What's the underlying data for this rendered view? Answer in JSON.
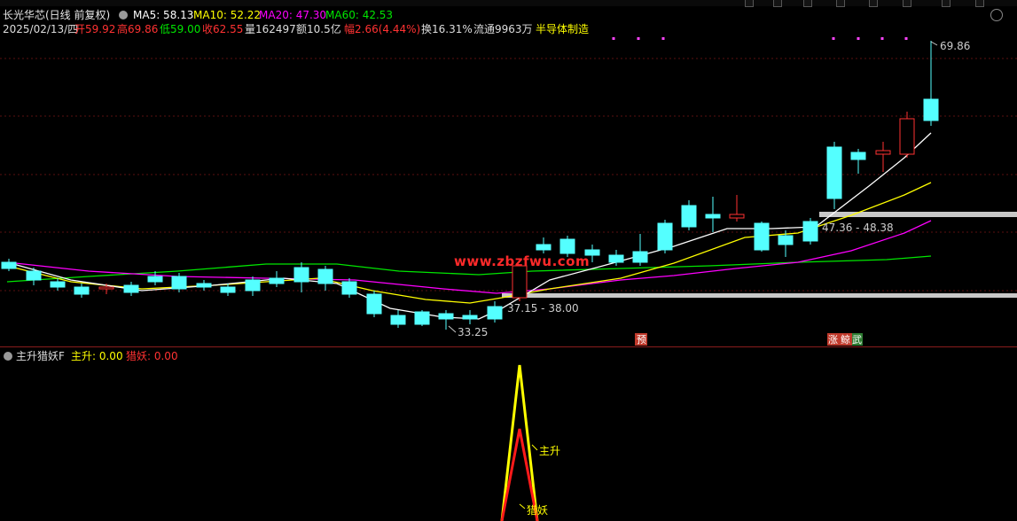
{
  "header": {
    "stock_name": "长光华芯(日线 前复权)",
    "ma5_label": "MA5: 58.13",
    "ma10_label": "MA10: 52.22",
    "ma20_label": "MA20: 47.30",
    "ma60_label": "MA60: 42.53",
    "date": "2025/02/13/四",
    "open": "开59.92",
    "high": "高69.86",
    "low": "低59.00",
    "close": "收62.55",
    "volume": "量162497",
    "amount": "额10.5亿",
    "change": "幅2.66(4.44%)",
    "turnover": "换16.31%",
    "float": "流通9963万",
    "sector": "半导体制造"
  },
  "chart": {
    "annotation_high": "69.86",
    "annotation_low": "33.25",
    "annotation_range1": "37.15 - 38.00",
    "annotation_range2": "47.36 - 48.38",
    "marker_yu": "预",
    "marker_zhang": "涨",
    "marker_jing": "鲸",
    "marker_wu": "武",
    "watermark": "www.zbzfwu.com"
  },
  "indicator": {
    "name": "主升猎妖F",
    "zhusheng_label": "主升: 0.00",
    "lieyao_label": "猎妖: 0.00",
    "zhusheng_arrow": "主升",
    "lieyao_arrow": "猎妖"
  },
  "colors": {
    "up": "#ff3232",
    "down": "#54ffff",
    "ma5": "#ffffff",
    "ma10": "#ffff00",
    "ma20": "#ff00ff",
    "ma60": "#00e600"
  }
}
